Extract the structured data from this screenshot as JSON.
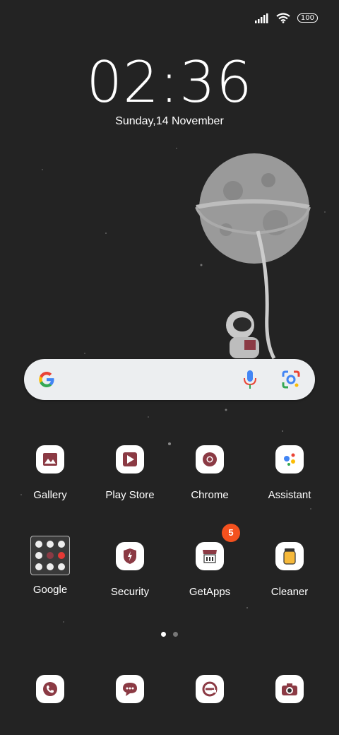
{
  "status_bar": {
    "battery": "100"
  },
  "lockclock": {
    "time": "02:36",
    "date": "Sunday,14 November"
  },
  "colors": {
    "background": "#232323",
    "accent_badge": "#f4511e",
    "icon_red": "#8b3a44"
  },
  "apps_row1": [
    {
      "label": "Gallery",
      "icon": "gallery-icon"
    },
    {
      "label": "Play Store",
      "icon": "play-store-icon"
    },
    {
      "label": "Chrome",
      "icon": "chrome-icon"
    },
    {
      "label": "Assistant",
      "icon": "assistant-icon"
    }
  ],
  "apps_row2": [
    {
      "label": "Google",
      "icon": "folder-icon"
    },
    {
      "label": "Security",
      "icon": "shield-icon"
    },
    {
      "label": "GetApps",
      "icon": "store-icon",
      "badge": "5"
    },
    {
      "label": "Cleaner",
      "icon": "cleaner-icon"
    }
  ],
  "dock": [
    {
      "icon": "phone-icon"
    },
    {
      "icon": "messages-icon"
    },
    {
      "icon": "browser-icon"
    },
    {
      "icon": "camera-icon"
    }
  ],
  "pager": {
    "pages": 2,
    "current": 1
  }
}
